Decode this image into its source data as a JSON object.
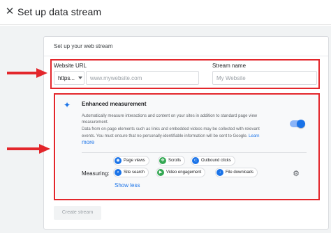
{
  "header": {
    "close_icon": "close-icon",
    "title": "Set up data stream"
  },
  "card": {
    "title": "Set up your web stream"
  },
  "form": {
    "website_url_label": "Website URL",
    "protocol_value": "https...",
    "url_placeholder": "www.mywebsite.com",
    "stream_name_label": "Stream name",
    "stream_name_placeholder": "My Website"
  },
  "enhanced": {
    "icon": "sparkle-icon",
    "title": "Enhanced measurement",
    "desc_line_1": "Automatically measure interactions and content on your sites in addition to standard page view",
    "desc_line_2": "measurement.",
    "desc_line_3": "Data from on-page elements such as links and embedded videos may be collected with relevant",
    "desc_line_4": "events. You must ensure that no personally-identifiable information will be sent to Google.",
    "learn_more_1": "Learn",
    "learn_more_2": "more",
    "toggle_on": true,
    "measuring_label": "Measuring:",
    "chips": [
      {
        "label": "Page views",
        "icon": "eye-icon",
        "color": "#1a73e8"
      },
      {
        "label": "Scrolls",
        "icon": "scroll-icon",
        "color": "#34a853"
      },
      {
        "label": "Outbound clicks",
        "icon": "link-icon",
        "color": "#1a73e8"
      },
      {
        "label": "Site search",
        "icon": "search-icon",
        "color": "#1a73e8"
      },
      {
        "label": "Video engagement",
        "icon": "play-icon",
        "color": "#34a853"
      },
      {
        "label": "File downloads",
        "icon": "download-icon",
        "color": "#1a73e8"
      }
    ],
    "show_less": "Show less",
    "settings_icon": "gear-icon"
  },
  "actions": {
    "create_stream": "Create stream"
  },
  "colors": {
    "accent": "#1a73e8",
    "highlight_box": "#e3262b",
    "arrow": "#e3262b"
  }
}
